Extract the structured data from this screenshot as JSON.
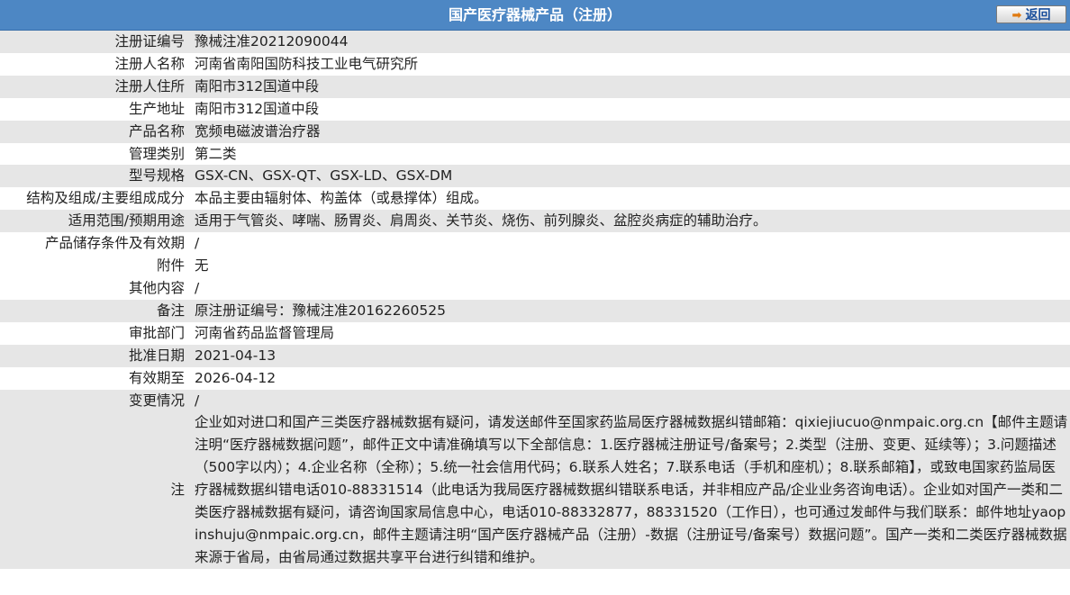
{
  "header": {
    "title": "国产医疗器械产品（注册）",
    "back_label": "返回",
    "back_icon": "arrow-right-icon"
  },
  "fields": [
    {
      "label": "注册证编号",
      "value": "豫械注准20212090044"
    },
    {
      "label": "注册人名称",
      "value": "河南省南阳国防科技工业电气研究所"
    },
    {
      "label": "注册人住所",
      "value": "南阳市312国道中段"
    },
    {
      "label": "生产地址",
      "value": "南阳市312国道中段"
    },
    {
      "label": "产品名称",
      "value": "宽频电磁波谱治疗器"
    },
    {
      "label": "管理类别",
      "value": "第二类"
    },
    {
      "label": "型号规格",
      "value": "GSX-CN、GSX-QT、GSX-LD、GSX-DM"
    },
    {
      "label": "结构及组成/主要组成成分",
      "value": "本品主要由辐射体、构盖体（或悬撑体）组成。"
    },
    {
      "label": "适用范围/预期用途",
      "value": "适用于气管炎、哮喘、肠胃炎、肩周炎、关节炎、烧伤、前列腺炎、盆腔炎病症的辅助治疗。"
    },
    {
      "label": "产品储存条件及有效期",
      "value": "/"
    },
    {
      "label": "附件",
      "value": "无"
    },
    {
      "label": "其他内容",
      "value": "/"
    },
    {
      "label": "备注",
      "value": "原注册证编号：豫械注准20162260525"
    },
    {
      "label": "审批部门",
      "value": "河南省药品监督管理局"
    },
    {
      "label": "批准日期",
      "value": "2021-04-13"
    },
    {
      "label": "有效期至",
      "value": "2026-04-12"
    }
  ],
  "change": {
    "label": "变更情况",
    "value": "/"
  },
  "note": {
    "label": "注",
    "value": "企业如对进口和国产三类医疗器械数据有疑问，请发送邮件至国家药监局医疗器械数据纠错邮箱：qixiejiucuo@nmpaic.org.cn【邮件主题请注明“医疗器械数据问题”，邮件正文中请准确填写以下全部信息：1.医疗器械注册证号/备案号；2.类型（注册、变更、延续等）；3.问题描述（500字以内）；4.企业名称（全称）；5.统一社会信用代码；6.联系人姓名；7.联系电话（手机和座机）；8.联系邮箱】，或致电国家药监局医疗器械数据纠错电话010-88331514（此电话为我局医疗器械数据纠错联系电话，并非相应产品/企业业务咨询电话）。企业如对国产一类和二类医疗器械数据有疑问，请咨询国家局信息中心，电话010-88332877，88331520（工作日），也可通过发邮件与我们联系：邮件地址yaopinshuju@nmpaic.org.cn，邮件主题请注明“国产医疗器械产品（注册）-数据（注册证号/备案号）数据问题”。国产一类和二类医疗器械数据来源于省局，由省局通过数据共享平台进行纠错和维护。"
  },
  "colors": {
    "header_bg": "#4d87c4",
    "row_alt_bg": "#e6e6e6",
    "row_bg": "#ffffff"
  }
}
